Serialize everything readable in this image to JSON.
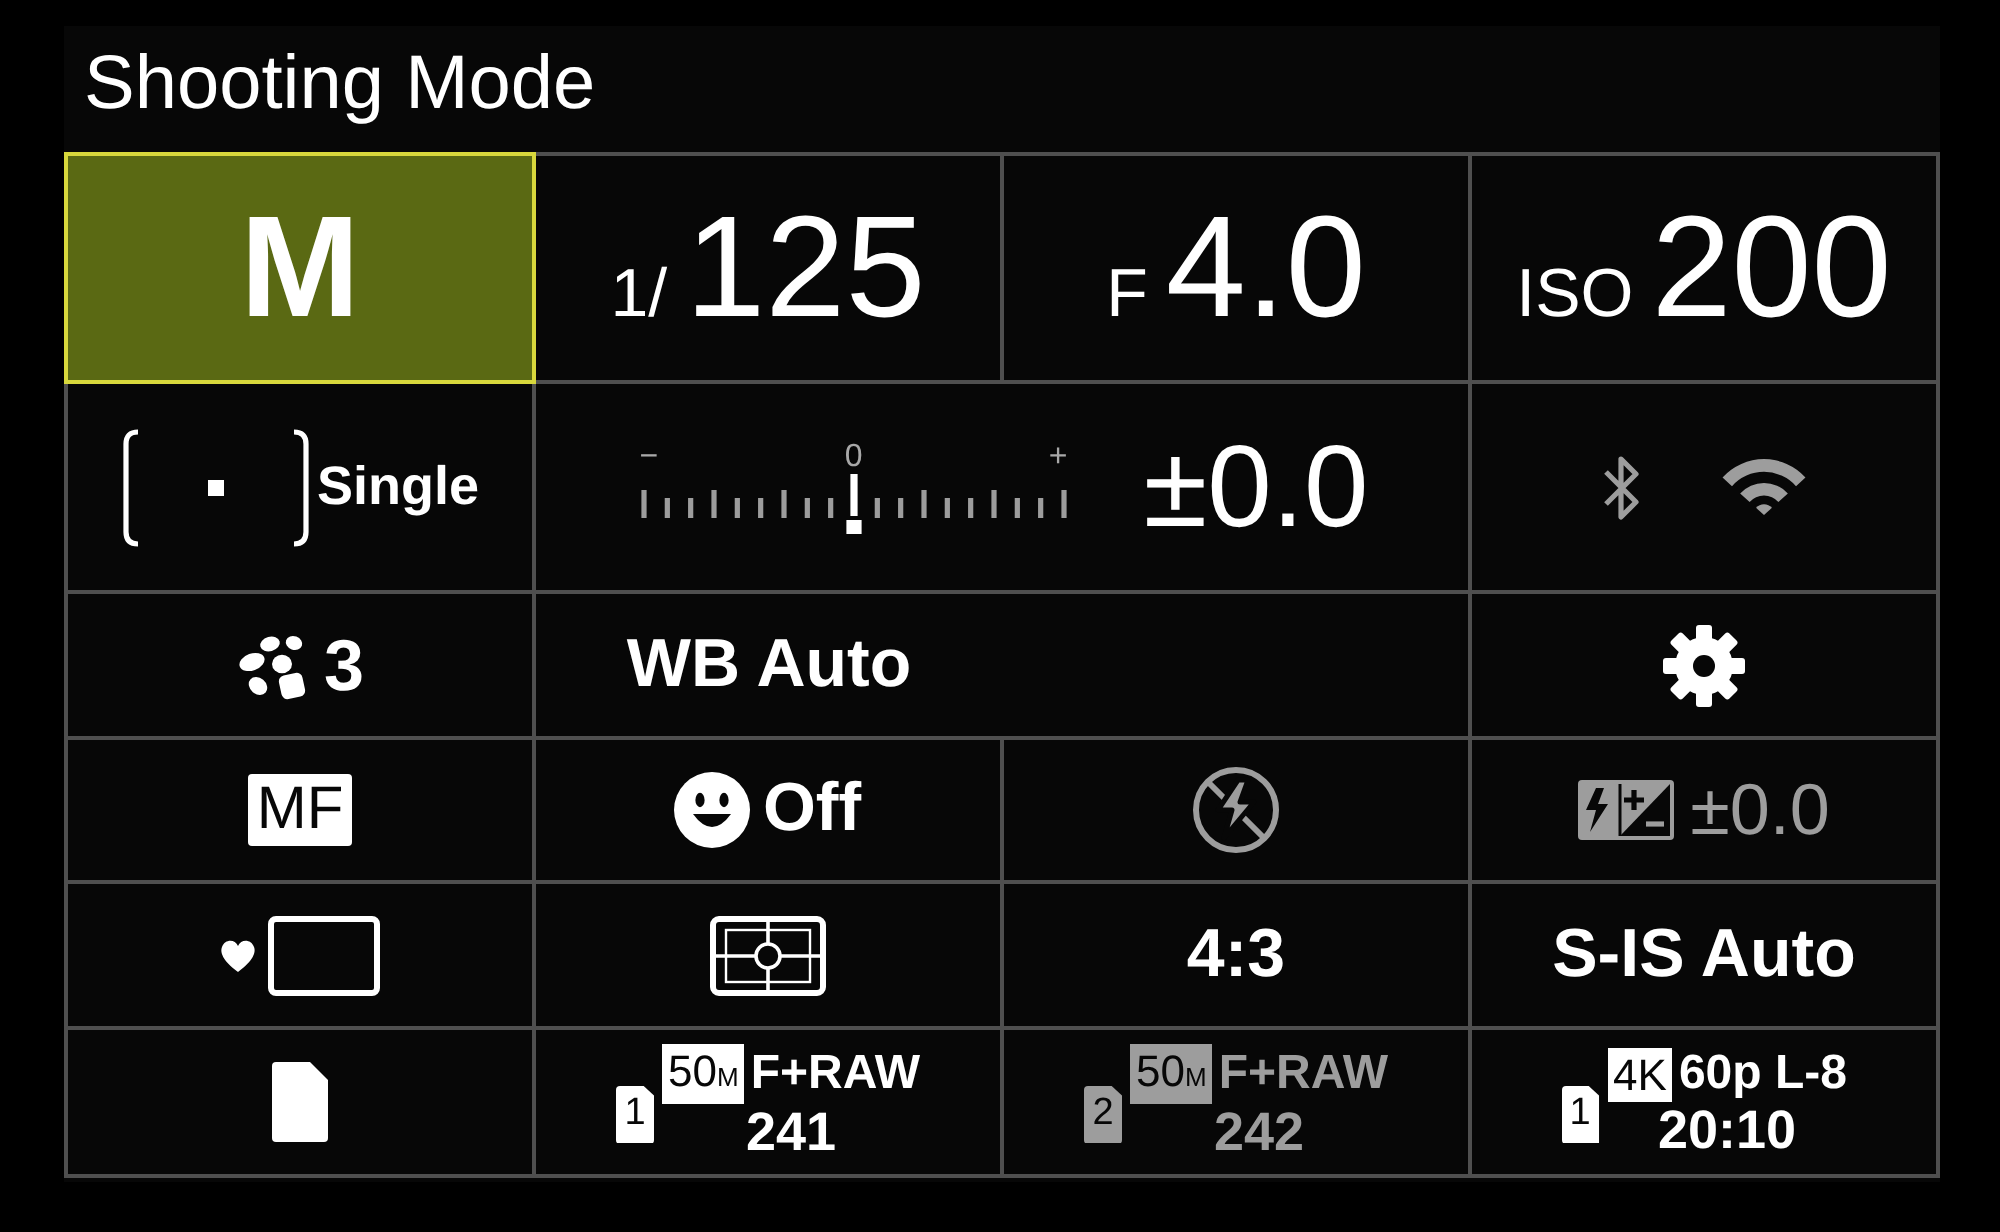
{
  "screen": {
    "title": "Shooting Mode"
  },
  "grid": {
    "rows": [
      {
        "cells": [
          {
            "kind": "mode",
            "value": "M",
            "selected": true,
            "disabled": false
          },
          {
            "kind": "reading",
            "prefix": "1/",
            "value": "125",
            "selected": false,
            "disabled": false
          },
          {
            "kind": "reading",
            "prefix": "F",
            "value": "4.0",
            "selected": false,
            "disabled": false
          },
          {
            "kind": "reading",
            "prefix": "ISO",
            "value": "200",
            "selected": false,
            "disabled": false
          }
        ]
      },
      {
        "cells": [
          {
            "kind": "drive",
            "label": "Single",
            "selected": false,
            "disabled": false
          },
          {
            "kind": "meter",
            "scale": [
              "−",
              "0",
              "+"
            ],
            "level": 0.5,
            "value": "±0.0",
            "selected": false,
            "disabled": false
          },
          {
            "kind": "wireless",
            "selected": false,
            "disabled": true
          }
        ]
      },
      {
        "cells": [
          {
            "kind": "picture",
            "value": "3",
            "selected": false,
            "disabled": false
          },
          {
            "kind": "text",
            "label": "WB Auto",
            "selected": false,
            "disabled": false
          },
          {
            "kind": "gear",
            "selected": false,
            "disabled": false
          }
        ]
      },
      {
        "cells": [
          {
            "kind": "badge",
            "label": "MF",
            "selected": false,
            "disabled": false
          },
          {
            "kind": "face",
            "label": "Off",
            "selected": false,
            "disabled": false
          },
          {
            "kind": "flash",
            "selected": false,
            "disabled": true
          },
          {
            "kind": "flashcomp",
            "value": "±0.0",
            "selected": false,
            "disabled": true
          }
        ]
      },
      {
        "cells": [
          {
            "kind": "frame",
            "selected": false,
            "disabled": false
          },
          {
            "kind": "metering",
            "selected": false,
            "disabled": false
          },
          {
            "kind": "text",
            "label": "4:3",
            "selected": false,
            "disabled": false
          },
          {
            "kind": "text",
            "label": "S-IS Auto",
            "selected": false,
            "disabled": false
          }
        ]
      },
      {
        "cells": [
          {
            "kind": "card",
            "selected": false,
            "disabled": false
          },
          {
            "kind": "storage",
            "slot": "1",
            "size": "50$_{M}$",
            "format": "F+RAW",
            "remaining": "241",
            "selected": false,
            "disabled": false
          },
          {
            "kind": "storage",
            "slot": "2",
            "size": "50$_{M}$",
            "format": "F+RAW",
            "remaining": "242",
            "selected": false,
            "disabled": true
          },
          {
            "kind": "storage",
            "slot": "1",
            "size": "4K",
            "format": "60p L-8",
            "remaining": "20:10",
            "selected": false,
            "disabled": false
          }
        ]
      }
    ]
  }
}
